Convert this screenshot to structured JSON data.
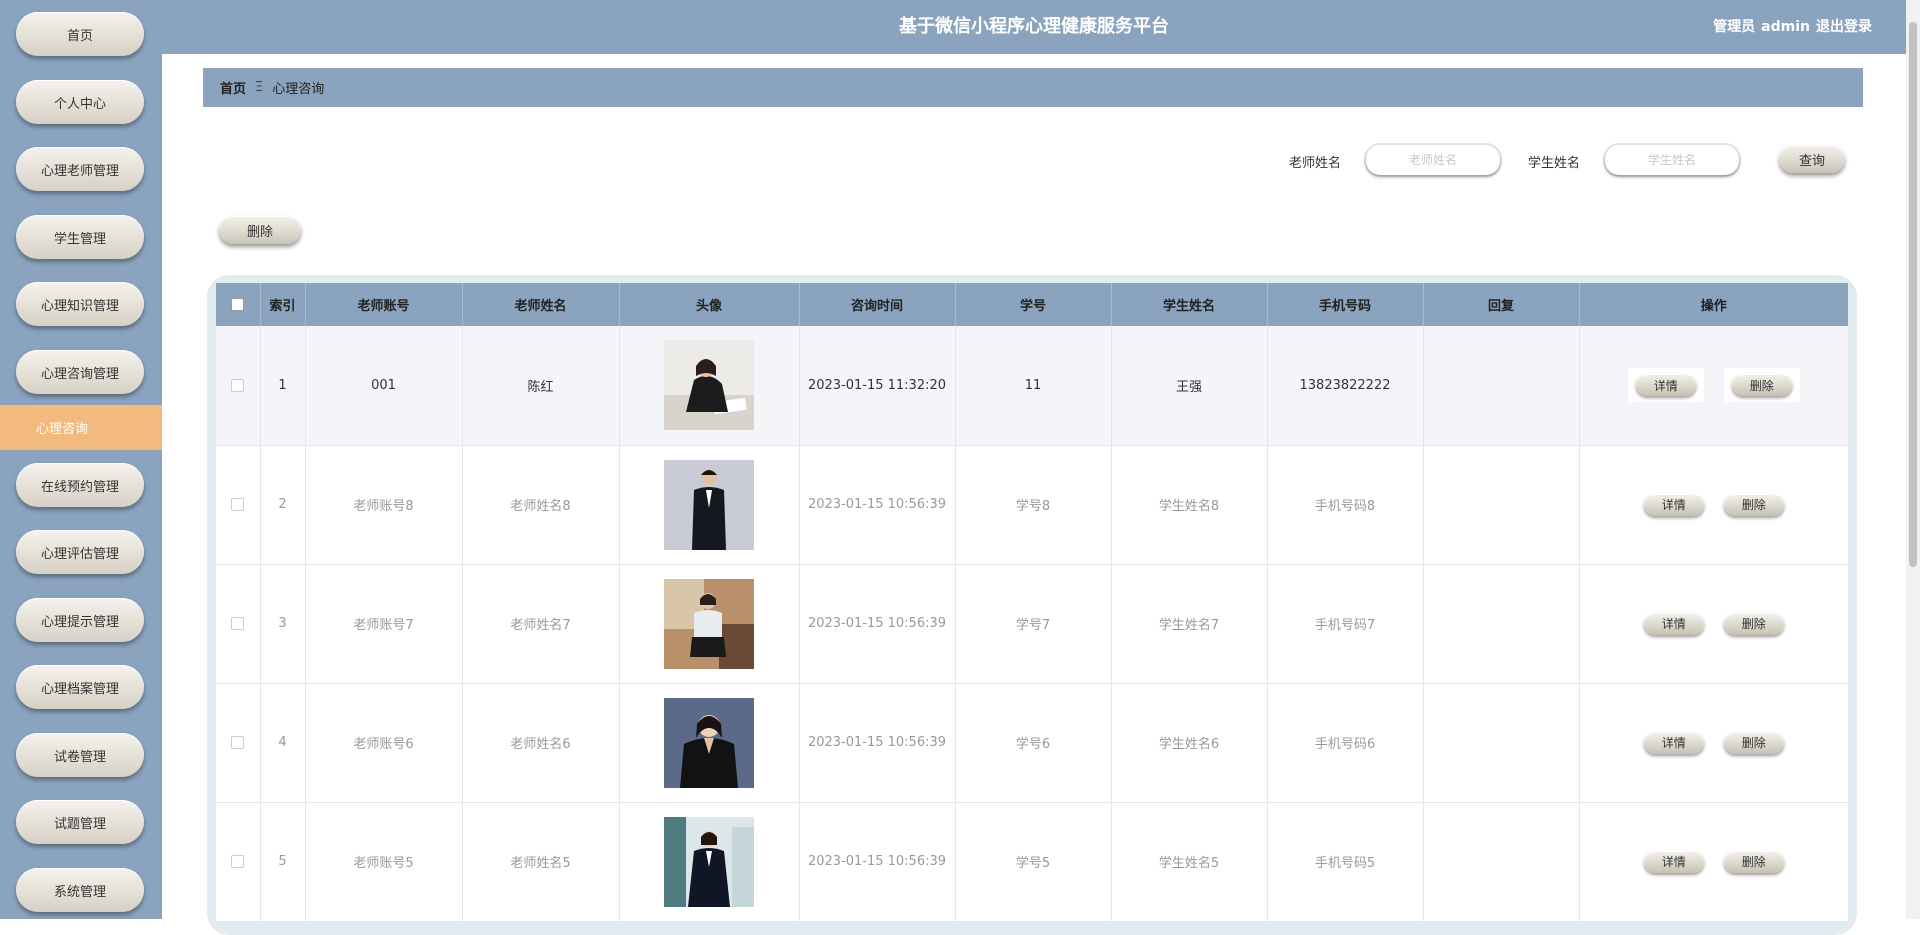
{
  "app": {
    "title": "基于微信小程序心理健康服务平台",
    "user_role": "管理员",
    "user_name": "admin",
    "logout": "退出登录"
  },
  "sidebar": {
    "items": [
      {
        "label": "首页"
      },
      {
        "label": "个人中心"
      },
      {
        "label": "心理老师管理"
      },
      {
        "label": "学生管理"
      },
      {
        "label": "心理知识管理"
      },
      {
        "label": "心理咨询管理"
      },
      {
        "label": "在线预约管理"
      },
      {
        "label": "心理评估管理"
      },
      {
        "label": "心理提示管理"
      },
      {
        "label": "心理档案管理"
      },
      {
        "label": "试卷管理"
      },
      {
        "label": "试题管理"
      },
      {
        "label": "系统管理"
      }
    ],
    "active_sub": "心理咨询"
  },
  "breadcrumb": {
    "home": "首页",
    "separator": "Ξ",
    "current": "心理咨询"
  },
  "search": {
    "teacher_label": "老师姓名",
    "teacher_placeholder": "老师姓名",
    "student_label": "学生姓名",
    "student_placeholder": "学生姓名",
    "query_button": "查询"
  },
  "toolbar": {
    "delete_button": "删除"
  },
  "table": {
    "columns": [
      "索引",
      "老师账号",
      "老师姓名",
      "头像",
      "咨询时间",
      "学号",
      "学生姓名",
      "手机号码",
      "回复",
      "操作"
    ],
    "detail_label": "详情",
    "delete_label": "删除",
    "rows": [
      {
        "index": "1",
        "teacher_account": "001",
        "teacher_name": "陈红",
        "time": "2023-01-15 11:32:20",
        "student_no": "11",
        "student_name": "王强",
        "phone": "13823822222",
        "reply": ""
      },
      {
        "index": "2",
        "teacher_account": "老师账号8",
        "teacher_name": "老师姓名8",
        "time": "2023-01-15 10:56:39",
        "student_no": "学号8",
        "student_name": "学生姓名8",
        "phone": "手机号码8",
        "reply": ""
      },
      {
        "index": "3",
        "teacher_account": "老师账号7",
        "teacher_name": "老师姓名7",
        "time": "2023-01-15 10:56:39",
        "student_no": "学号7",
        "student_name": "学生姓名7",
        "phone": "手机号码7",
        "reply": ""
      },
      {
        "index": "4",
        "teacher_account": "老师账号6",
        "teacher_name": "老师姓名6",
        "time": "2023-01-15 10:56:39",
        "student_no": "学号6",
        "student_name": "学生姓名6",
        "phone": "手机号码6",
        "reply": ""
      },
      {
        "index": "5",
        "teacher_account": "老师账号5",
        "teacher_name": "老师姓名5",
        "time": "2023-01-15 10:56:39",
        "student_no": "学号5",
        "student_name": "学生姓名5",
        "phone": "手机号码5",
        "reply": ""
      }
    ]
  },
  "colors": {
    "primary": "#8aa3bf",
    "active": "#f2ba7e",
    "table_frame": "#e1ecf0"
  }
}
